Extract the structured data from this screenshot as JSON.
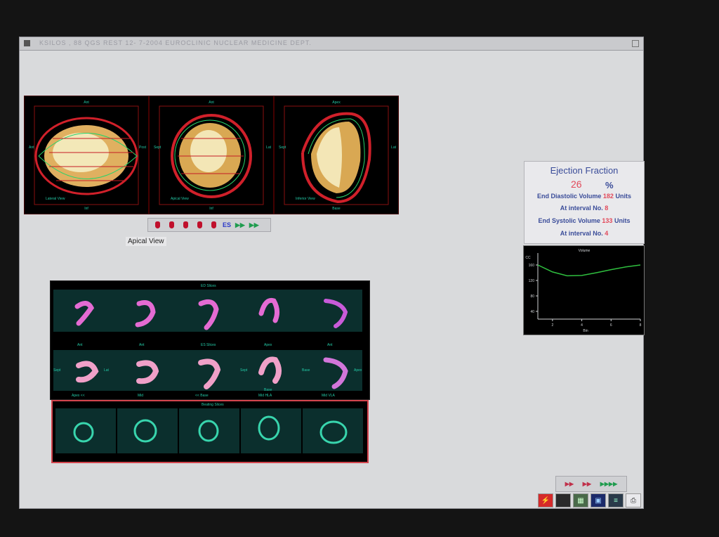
{
  "window": {
    "title": "KSILOS , 88 QGS REST 12- 7-2004 EUROCLINIC NUCLEAR MEDICINE DEPT."
  },
  "views3d": [
    {
      "top": "Ant",
      "bottom": "Inf",
      "left": "Ant",
      "right": "Post",
      "view": "Lateral View"
    },
    {
      "top": "Ant",
      "bottom": "Inf",
      "left": "Sept",
      "right": "Lat",
      "view": "Apical View"
    },
    {
      "top": "Apex",
      "bottom": "Base",
      "left": "Sept",
      "right": "Lat",
      "view": "Inferior View"
    }
  ],
  "toolbar3d": {
    "es_label": "ES",
    "tooltip": "Apical View"
  },
  "ejection": {
    "title": "Ejection Fraction",
    "ef_value": "26",
    "ef_unit": "%",
    "edv_label": "End Diastolic Volume",
    "edv_value": "182",
    "edv_unit": "Units",
    "ed_interval_label": "At interval No.",
    "ed_interval": "8",
    "esv_label": "End Systolic Volume",
    "esv_value": "133",
    "esv_unit": "Units",
    "es_interval_label": "At interval No.",
    "es_interval": "4"
  },
  "chart_data": {
    "type": "line",
    "title": "Volume",
    "ylabel": "CC",
    "xlabel": "Bin",
    "ylim": [
      20,
      180
    ],
    "xlim": [
      1,
      8
    ],
    "yticks": [
      40,
      80,
      120,
      160
    ],
    "xticks": [
      2,
      4,
      6,
      8
    ],
    "x": [
      1,
      2,
      3,
      4,
      5,
      6,
      7,
      8
    ],
    "series": [
      {
        "values": [
          160,
          142,
          132,
          133,
          140,
          148,
          155,
          160
        ]
      }
    ]
  },
  "slices": {
    "row1_header": "ED Slices",
    "row2_header": "ES Slices",
    "row3_header": "Beating Slices",
    "row2_labels": [
      "Ant",
      "Ant",
      "Apex",
      "Ant"
    ],
    "row2_side_labels": [
      "Sept",
      "Lat",
      "Sept",
      "Base",
      "Apex"
    ],
    "row2_bottom": [
      "Apex <<",
      "Mid",
      "<< Base",
      "Mid HLA",
      "Mid VLA"
    ],
    "row2_bottom_extra": "Base"
  },
  "colors": {
    "accent_text": "#3a4c99",
    "value_red": "#e2495a",
    "overlay_green": "#23c9a6"
  }
}
